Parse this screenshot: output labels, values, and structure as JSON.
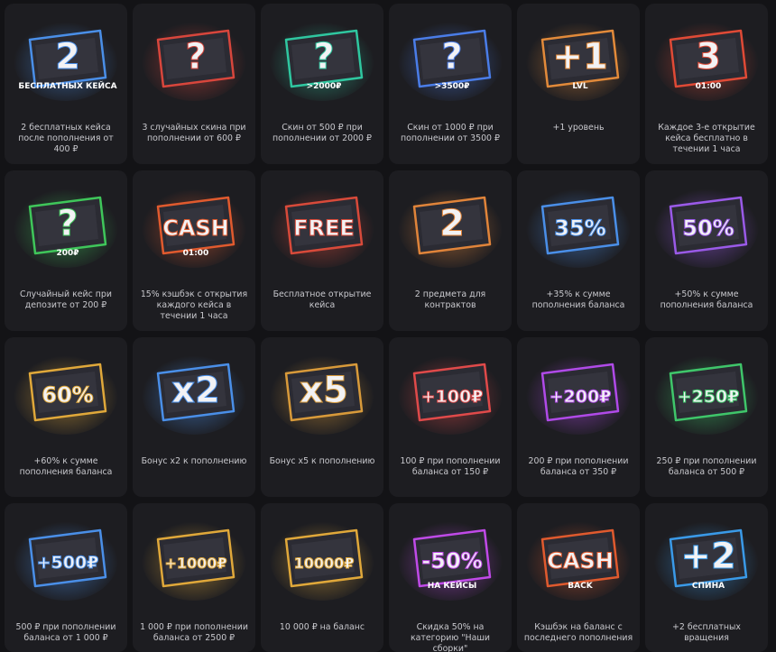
{
  "bonuses": [
    {
      "text": "2 бесплатных кейса после пополнения от 400 ₽",
      "icon": "two-free-cases-icon",
      "badge": "2",
      "sub": "БЕСПЛАТНЫХ КЕЙСА",
      "color": "#4a8fe8"
    },
    {
      "text": "3 случайных скина при пополнении от 600 ₽",
      "icon": "random-skins-icon",
      "badge": "?",
      "sub": "",
      "color": "#d8463c"
    },
    {
      "text": "Скин от 500 ₽ при пополнении от 2000 ₽",
      "icon": "skin-2000-icon",
      "badge": "?",
      "sub": ">2000₽",
      "color": "#2fc7a0"
    },
    {
      "text": "Скин от 1000 ₽ при пополнении от 3500 ₽",
      "icon": "skin-3500-icon",
      "badge": "?",
      "sub": ">3500₽",
      "color": "#4a7de8"
    },
    {
      "text": "+1 уровень",
      "icon": "level-up-icon",
      "badge": "+1",
      "sub": "LVL",
      "color": "#e28a3a"
    },
    {
      "text": "Каждое 3-е открытие кейса бесплатно в течении 1 часа",
      "icon": "third-free-icon",
      "badge": "3",
      "sub": "01:00",
      "color": "#e04a36"
    },
    {
      "text": "Случайный кейс при депозите от 200 ₽",
      "icon": "random-case-icon",
      "badge": "?",
      "sub": "200₽",
      "color": "#3fc65a"
    },
    {
      "text": "15% кэшбэк с открытия каждого кейса в течении 1 часа",
      "icon": "cashback-hour-icon",
      "badge": "CASH",
      "sub": "01:00",
      "color": "#e05a2e"
    },
    {
      "text": "Бесплатное открытие кейса",
      "icon": "free-open-icon",
      "badge": "FREE",
      "sub": "",
      "color": "#d84a3a"
    },
    {
      "text": "2 предмета для контрактов",
      "icon": "contract-items-icon",
      "badge": "2",
      "sub": "",
      "color": "#e0843a"
    },
    {
      "text": "+35% к сумме пополнения баланса",
      "icon": "plus-35-icon",
      "badge": "35%",
      "sub": "",
      "color": "#4a8fe8"
    },
    {
      "text": "+50% к сумме пополнения баланса",
      "icon": "plus-50-icon",
      "badge": "50%",
      "sub": "",
      "color": "#9a5ae8"
    },
    {
      "text": "+60% к сумме пополнения баланса",
      "icon": "plus-60-icon",
      "badge": "60%",
      "sub": "",
      "color": "#e0a83a"
    },
    {
      "text": "Бонус x2 к пополнению",
      "icon": "bonus-x2-icon",
      "badge": "x2",
      "sub": "",
      "color": "#4a8fe8"
    },
    {
      "text": "Бонус x5 к пополнению",
      "icon": "bonus-x5-icon",
      "badge": "x5",
      "sub": "",
      "color": "#d89a3a"
    },
    {
      "text": "100 ₽ при пополнении баланса от 150 ₽",
      "icon": "plus-100-icon",
      "badge": "+100₽",
      "sub": "",
      "color": "#e04a4a"
    },
    {
      "text": "200 ₽ при пополнении баланса от 350 ₽",
      "icon": "plus-200-icon",
      "badge": "+200₽",
      "sub": "",
      "color": "#b04ae8"
    },
    {
      "text": "250 ₽ при пополнении баланса от 500 ₽",
      "icon": "plus-250-icon",
      "badge": "+250₽",
      "sub": "",
      "color": "#3fc66a"
    },
    {
      "text": "500 ₽ при пополнении баланса от 1 000 ₽",
      "icon": "plus-500-icon",
      "badge": "+500₽",
      "sub": "",
      "color": "#4a8fe8"
    },
    {
      "text": "1 000 ₽ при пополнении баланса от 2500 ₽",
      "icon": "plus-1000-icon",
      "badge": "+1000₽",
      "sub": "",
      "color": "#e0a83a"
    },
    {
      "text": "10 000 ₽ на баланс",
      "icon": "plus-10000-icon",
      "badge": "10000₽",
      "sub": "",
      "color": "#e0a83a"
    },
    {
      "text": "Скидка 50% на категорию \"Наши сборки\"",
      "icon": "discount-50-icon",
      "badge": "-50%",
      "sub": "НА КЕЙСЫ",
      "color": "#c04ae8"
    },
    {
      "text": "Кэшбэк на баланс с последнего пополнения",
      "icon": "cashback-balance-icon",
      "badge": "CASH",
      "sub": "BACK",
      "color": "#e05a2e"
    },
    {
      "text": "+2 бесплатных вращения",
      "icon": "free-spins-icon",
      "badge": "+2",
      "sub": "СПИНА",
      "color": "#3a9ae8"
    }
  ]
}
